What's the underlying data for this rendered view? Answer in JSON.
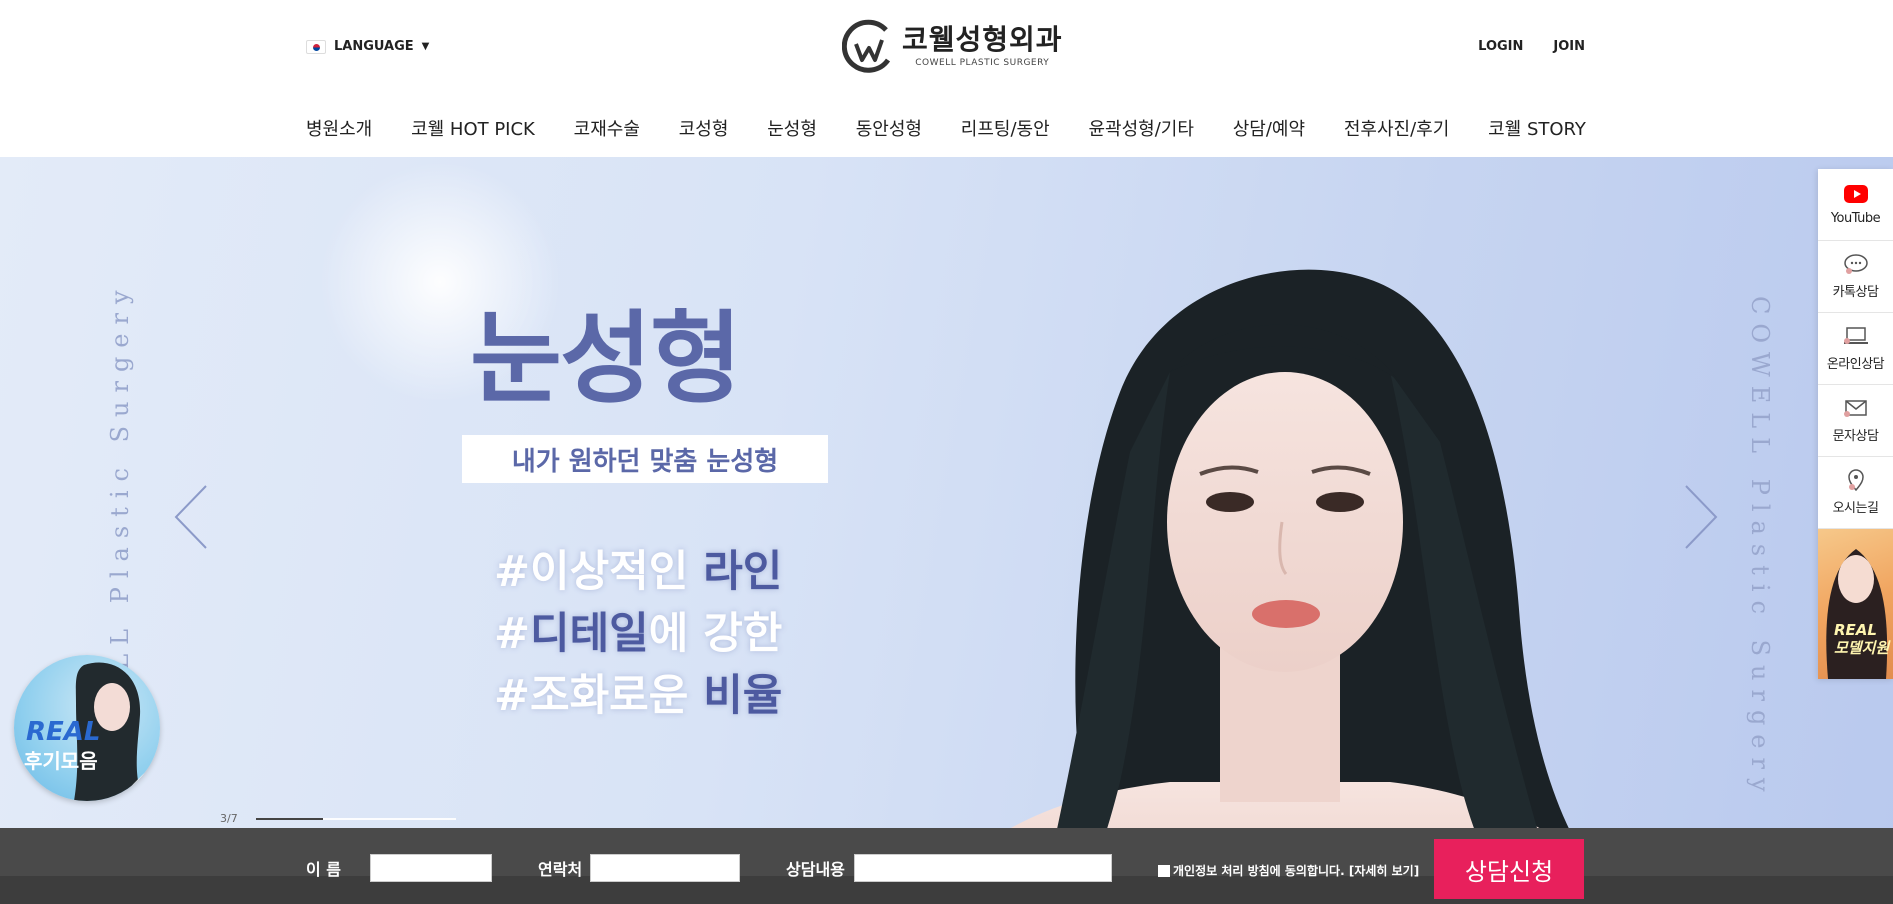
{
  "header": {
    "language_label": "LANGUAGE",
    "logo": {
      "name_ko": "코웰성형외과",
      "name_en": "COWELL PLASTIC SURGERY"
    },
    "auth": {
      "login": "LOGIN",
      "join": "JOIN"
    },
    "nav": [
      "병원소개",
      "코웰 HOT PICK",
      "코재수술",
      "코성형",
      "눈성형",
      "동안성형",
      "리프팅/동안",
      "윤곽성형/기타",
      "상담/예약",
      "전후사진/후기",
      "코웰 STORY"
    ]
  },
  "hero": {
    "title": "눈성형",
    "subtitle": "내가 원하던 맞춤 눈성형",
    "hashtags": [
      {
        "plain": "#이상적인 ",
        "em": "라인",
        "rest": ""
      },
      {
        "plain": "#",
        "em": "디테일",
        "rest": "에 강한"
      },
      {
        "plain": "#조화로운 ",
        "em": "비율",
        "rest": ""
      }
    ],
    "side_text_left": "COWELL Plastic Surgery",
    "side_text_right": "COWELL Plastic Surgery",
    "slide_counter": "3/7",
    "slide_current": 3,
    "slide_total": 7
  },
  "real_badge": {
    "line1": "REAL",
    "line2": "후기모음"
  },
  "quick_menu": [
    {
      "icon": "youtube-icon",
      "label": "YouTube"
    },
    {
      "icon": "kakao-chat-icon",
      "label": "카톡상담"
    },
    {
      "icon": "laptop-icon",
      "label": "온라인상담"
    },
    {
      "icon": "envelope-icon",
      "label": "문자상담"
    },
    {
      "icon": "location-pin-icon",
      "label": "오시는길"
    }
  ],
  "quick_banner_text": "REAL 모델지원",
  "form": {
    "name_label": "이  름",
    "phone_label": "연락처",
    "content_label": "상담내용",
    "agree_text": "개인정보 처리 방침에 동의합니다. [자세히 보기]",
    "submit_label": "상담신청"
  },
  "colors": {
    "accent_pink": "#e8205c",
    "hero_purple": "#5b68a8",
    "form_bar": "#4a4a4a"
  }
}
